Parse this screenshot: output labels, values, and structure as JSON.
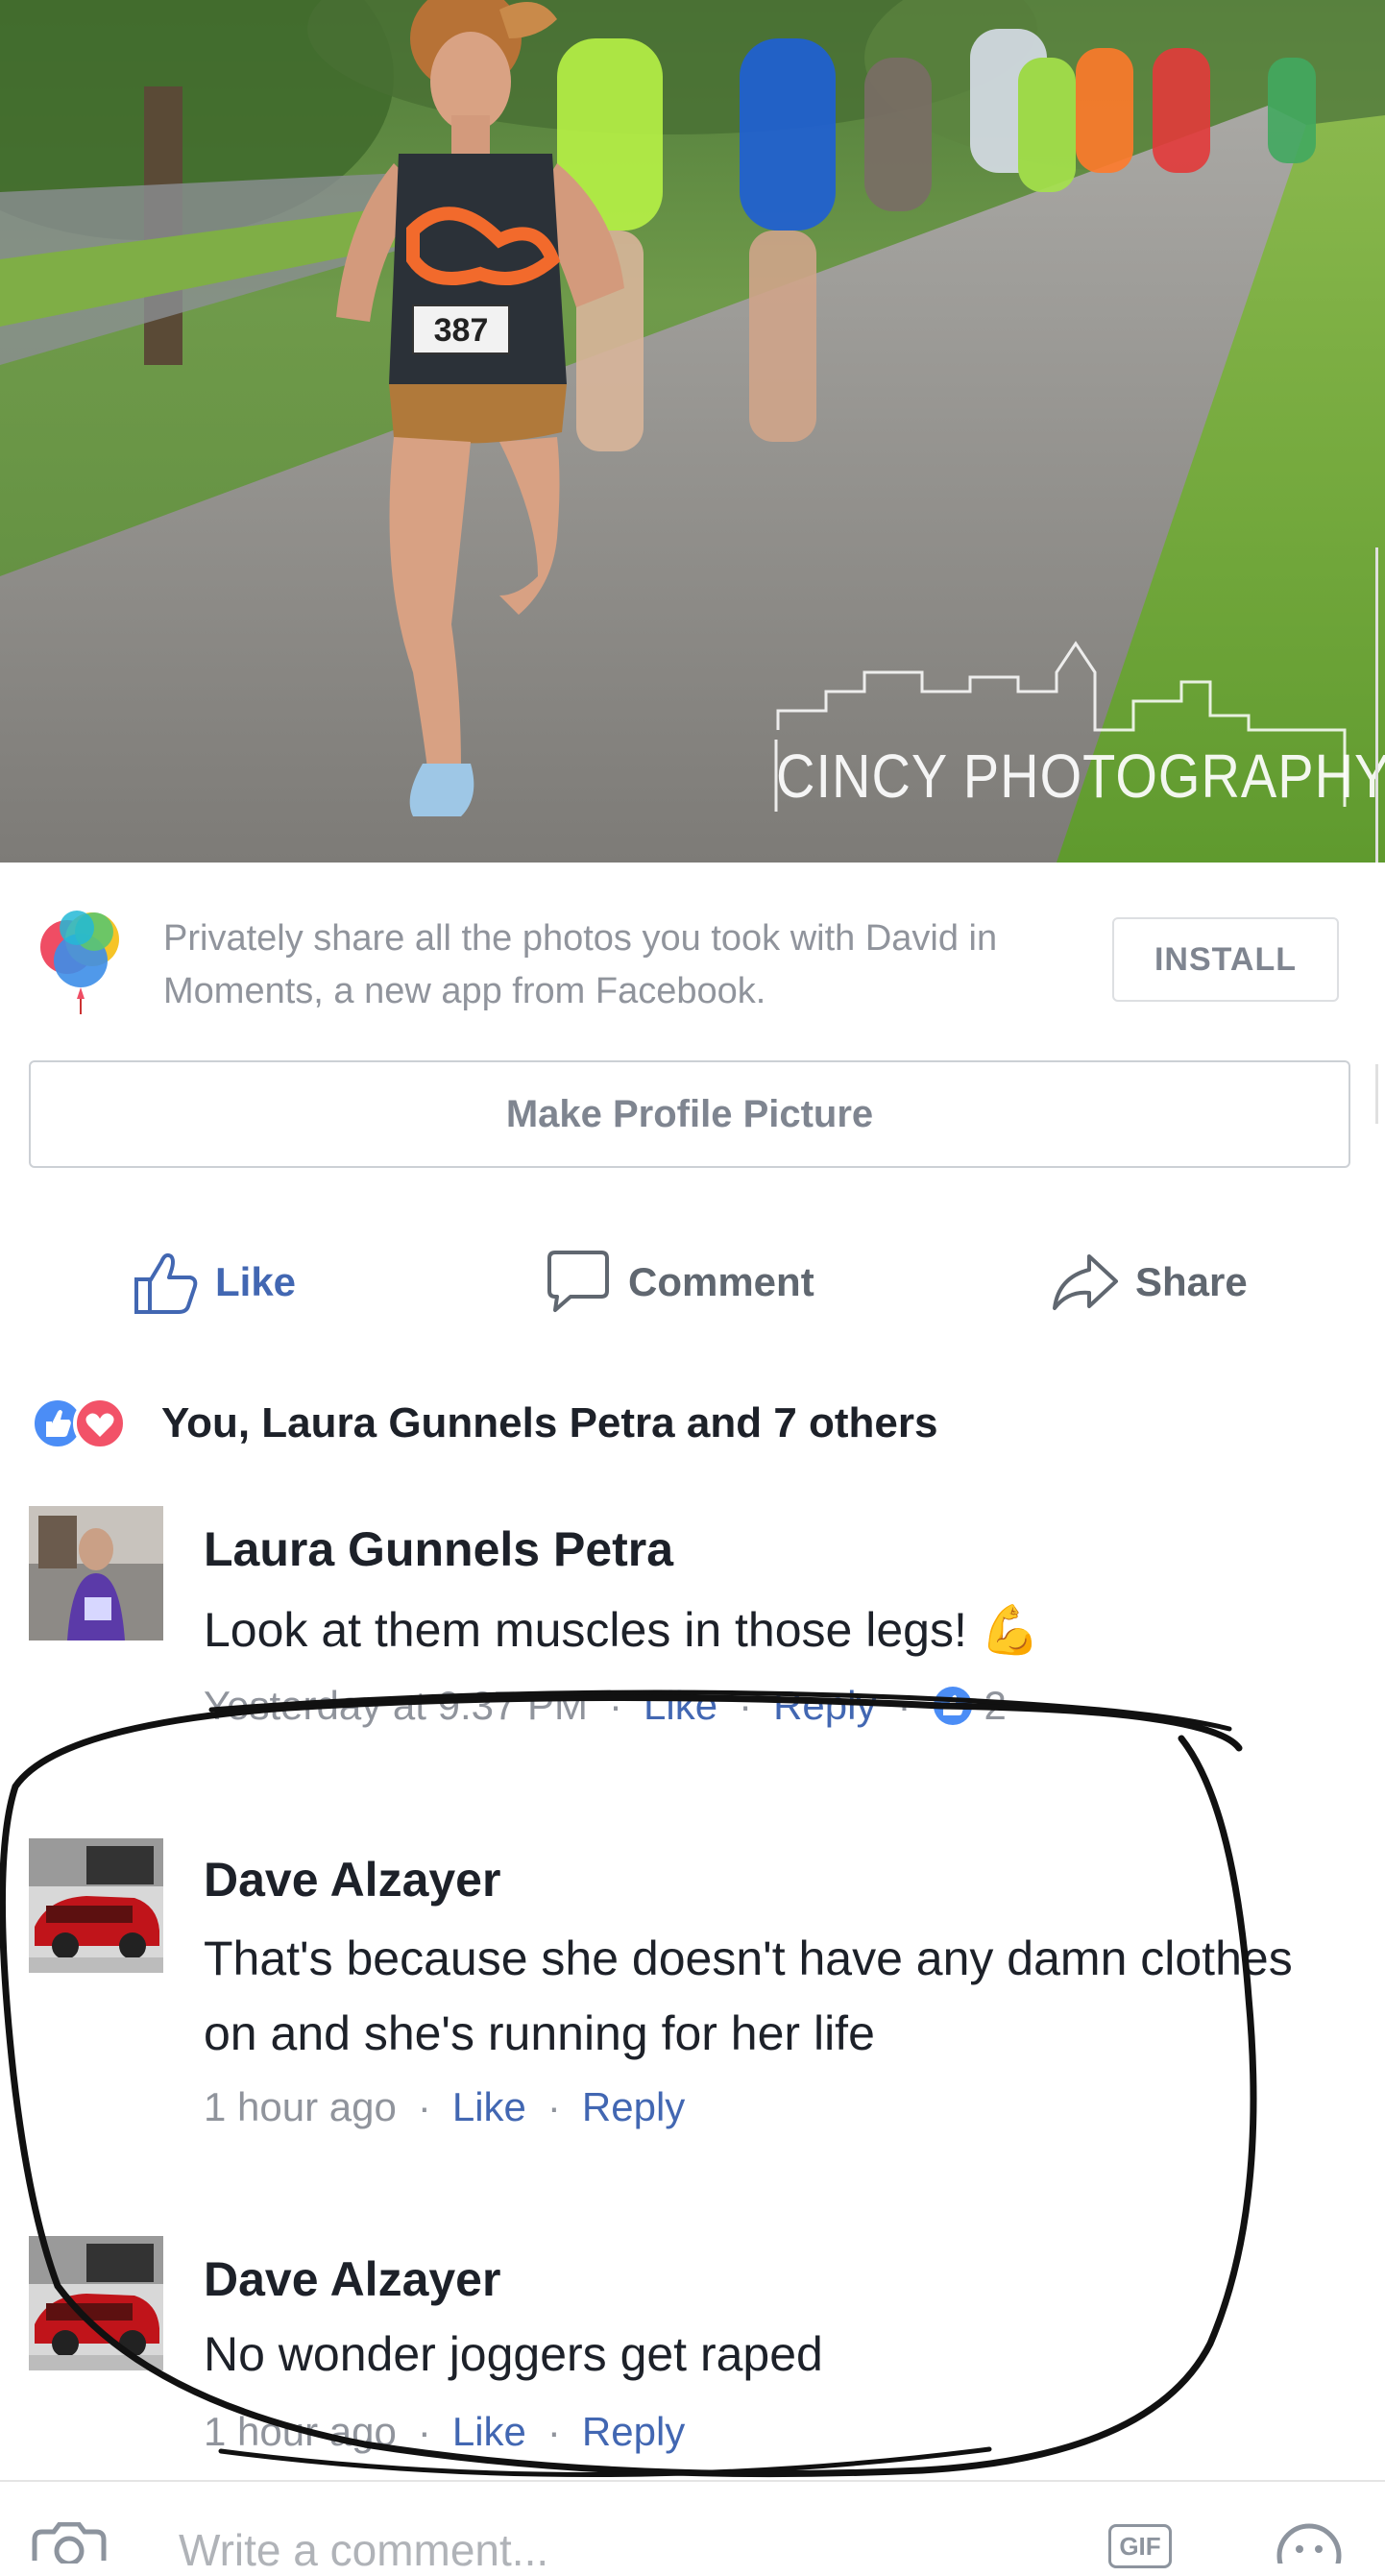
{
  "photo": {
    "watermark": "CINCY PHOTOGRAPHY",
    "bib_number": "387",
    "alt": ""
  },
  "promo": {
    "text": "Privately share all the photos you took with David in Moments, a new app from Facebook.",
    "install_label": "INSTALL",
    "icon": "moments-balloons-icon"
  },
  "profile_button": {
    "label": "Make Profile Picture"
  },
  "actions": {
    "like_label": "Like",
    "comment_label": "Comment",
    "share_label": "Share"
  },
  "reactions": {
    "summary": "You, Laura Gunnels Petra and 7 others",
    "types": [
      "like",
      "love"
    ]
  },
  "comments": [
    {
      "author": "Laura Gunnels Petra",
      "text": "Look at them muscles in those legs! 💪",
      "time": "Yesterday at 9:37 PM",
      "like_label": "Like",
      "reply_label": "Reply",
      "like_count": "2"
    },
    {
      "author": "Dave Alzayer",
      "text": "That's because she doesn't have any damn clothes on and she's running for her life",
      "time": "1 hour ago",
      "like_label": "Like",
      "reply_label": "Reply"
    },
    {
      "author": "Dave Alzayer",
      "text": "No wonder joggers get raped",
      "time": "1 hour ago",
      "like_label": "Like",
      "reply_label": "Reply"
    }
  ],
  "composer": {
    "placeholder": "Write a comment...",
    "gif_label": "GIF"
  },
  "colors": {
    "facebook_blue": "#4267b2",
    "meta_gray": "#90949c",
    "text_dark": "#1d2129",
    "love_red": "#f25268"
  }
}
